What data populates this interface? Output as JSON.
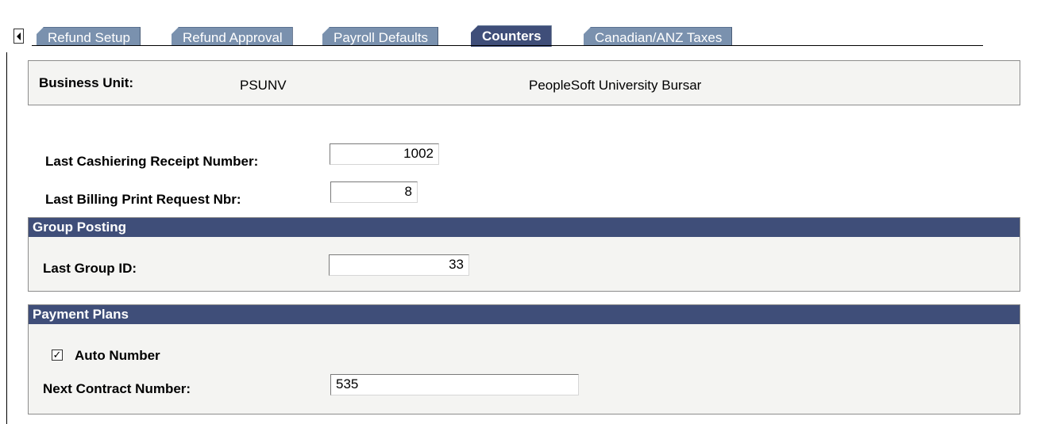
{
  "tabs": [
    {
      "label": "Refund Setup",
      "active": false
    },
    {
      "label": "Refund Approval",
      "active": false
    },
    {
      "label": "Payroll Defaults",
      "active": false
    },
    {
      "label": "Counters",
      "active": true
    },
    {
      "label": "Canadian/ANZ Taxes",
      "active": false
    }
  ],
  "business_unit": {
    "label": "Business Unit:",
    "code": "PSUNV",
    "description": "PeopleSoft University Bursar"
  },
  "counters": {
    "cashiering_label": "Last Cashiering Receipt Number:",
    "cashiering_value": "1002",
    "billing_label": "Last Billing Print Request Nbr:",
    "billing_value": "8"
  },
  "group_posting": {
    "title": "Group Posting",
    "last_group_label": "Last Group ID:",
    "last_group_value": "33"
  },
  "payment_plans": {
    "title": "Payment Plans",
    "auto_number_label": "Auto Number",
    "auto_number_checked": true,
    "auto_number_mark": "✓",
    "next_contract_label": "Next Contract Number:",
    "next_contract_value": "535"
  }
}
